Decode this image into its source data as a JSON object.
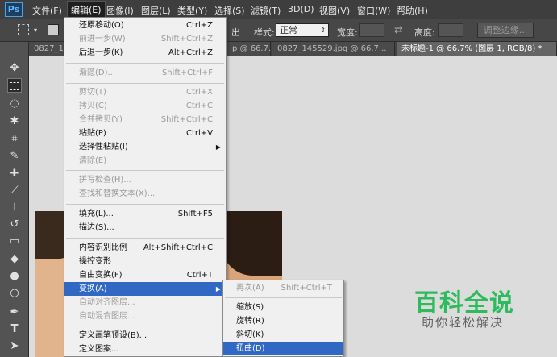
{
  "app": {
    "logo": "Ps"
  },
  "menubar": [
    "文件(F)",
    "编辑(E)",
    "图像(I)",
    "图层(L)",
    "类型(Y)",
    "选择(S)",
    "滤镜(T)",
    "3D(D)",
    "视图(V)",
    "窗口(W)",
    "帮助(H)"
  ],
  "options": {
    "partial_text": "出",
    "style_label": "样式:",
    "style_value": "正常",
    "width_label": "宽度:",
    "height_label": "高度:",
    "refine_button": "调整边缘..."
  },
  "tabs": {
    "partial1": "p @ 66.7...",
    "tab2": "0827_145529.jpg @ 66.7...",
    "tab3": "未标题-1 @ 66.7% (图层 1, RGB/8) *",
    "tab1_prefix": "0827_1"
  },
  "edit_menu": {
    "undo": {
      "label": "还原移动(O)",
      "shortcut": "Ctrl+Z"
    },
    "step_forward": {
      "label": "前进一步(W)",
      "shortcut": "Shift+Ctrl+Z"
    },
    "step_back": {
      "label": "后退一步(K)",
      "shortcut": "Alt+Ctrl+Z"
    },
    "fade": {
      "label": "渐隐(D)...",
      "shortcut": "Shift+Ctrl+F"
    },
    "cut": {
      "label": "剪切(T)",
      "shortcut": "Ctrl+X"
    },
    "copy": {
      "label": "拷贝(C)",
      "shortcut": "Ctrl+C"
    },
    "copy_merged": {
      "label": "合并拷贝(Y)",
      "shortcut": "Shift+Ctrl+C"
    },
    "paste": {
      "label": "粘贴(P)",
      "shortcut": "Ctrl+V"
    },
    "paste_special": {
      "label": "选择性粘贴(I)"
    },
    "clear": {
      "label": "清除(E)"
    },
    "spell_check": {
      "label": "拼写检查(H)..."
    },
    "find_replace": {
      "label": "查找和替换文本(X)..."
    },
    "fill": {
      "label": "填充(L)...",
      "shortcut": "Shift+F5"
    },
    "stroke": {
      "label": "描边(S)..."
    },
    "content_aware_scale": {
      "label": "内容识别比例",
      "shortcut": "Alt+Shift+Ctrl+C"
    },
    "puppet_warp": {
      "label": "操控变形"
    },
    "free_transform": {
      "label": "自由变换(F)",
      "shortcut": "Ctrl+T"
    },
    "transform": {
      "label": "变换(A)"
    },
    "auto_align": {
      "label": "自动对齐图层..."
    },
    "auto_blend": {
      "label": "自动混合图层..."
    },
    "define_brush": {
      "label": "定义画笔预设(B)..."
    },
    "define_pattern": {
      "label": "定义图案..."
    }
  },
  "transform_submenu": {
    "again": {
      "label": "再次(A)",
      "shortcut": "Shift+Ctrl+T"
    },
    "scale": {
      "label": "缩放(S)"
    },
    "rotate": {
      "label": "旋转(R)"
    },
    "skew": {
      "label": "斜切(K)"
    },
    "distort": {
      "label": "扭曲(D)"
    }
  },
  "watermark": {
    "title": "百科全说",
    "subtitle": "助你轻松解决"
  },
  "colors": {
    "highlight": "#3068c4",
    "watermark_green": "#2dbb5e"
  }
}
